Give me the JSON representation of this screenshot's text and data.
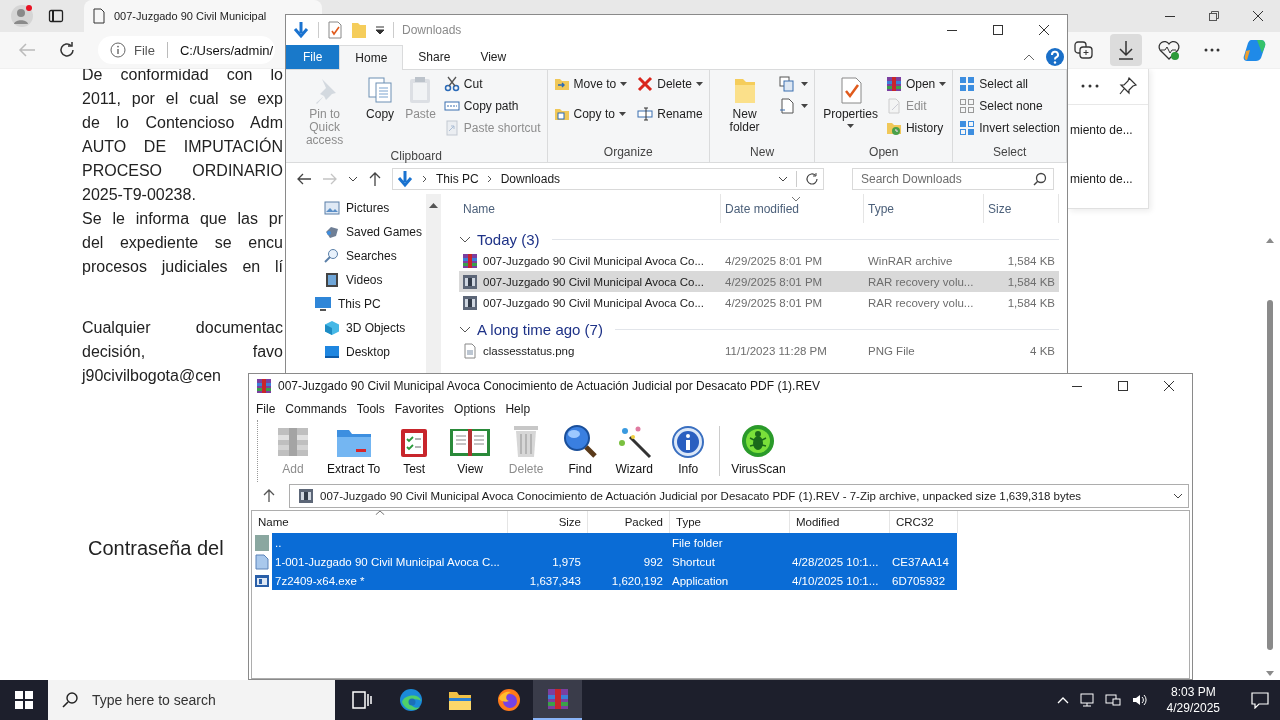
{
  "browser": {
    "tab": {
      "title": "007-Juzgado 90 Civil Municipal"
    },
    "address": {
      "scheme": "File",
      "path": "C:/Users/admin/"
    },
    "document": {
      "paragraphs": [
        {
          "lines": [
            "De conformidad con lo",
            "2011, por el cual se exp",
            "de lo Contencioso Adm",
            "AUTO DE IMPUTACIÓN",
            "PROCESO ORDINARIO",
            "2025-T9-00238.",
            "Se le informa que las pr",
            "del expediente se encu",
            "procesos judiciales en lí"
          ]
        },
        {
          "lines": [
            "Cualquier documentac",
            "decisión, favo",
            "j90civilbogota@cen"
          ]
        }
      ],
      "heading": "Contraseña del"
    },
    "downloads_panel": {
      "items": [
        "miento de...",
        "miento de..."
      ]
    }
  },
  "explorer": {
    "title": "Downloads",
    "tabs": [
      {
        "label": "File",
        "kind": "file",
        "selected": false
      },
      {
        "label": "Home",
        "kind": "tab",
        "selected": true
      },
      {
        "label": "Share",
        "kind": "tab",
        "selected": false
      },
      {
        "label": "View",
        "kind": "tab",
        "selected": false
      }
    ],
    "groups": [
      {
        "label": "Clipboard",
        "items": [
          {
            "kind": "large",
            "label": "Pin to Quick access",
            "disabled": true,
            "dropdown": false
          },
          {
            "kind": "large",
            "label": "Copy",
            "disabled": false,
            "dropdown": false
          },
          {
            "kind": "large",
            "label": "Paste",
            "disabled": true,
            "dropdown": false
          },
          {
            "kind": "small",
            "label": "Cut",
            "disabled": false,
            "dropdown": false
          },
          {
            "kind": "small",
            "label": "Copy path",
            "disabled": false,
            "dropdown": false
          },
          {
            "kind": "small",
            "label": "Paste shortcut",
            "disabled": true,
            "dropdown": false
          }
        ]
      },
      {
        "label": "Organize",
        "items": [
          {
            "kind": "small",
            "label": "Move to",
            "disabled": false,
            "dropdown": true
          },
          {
            "kind": "small",
            "label": "Copy to",
            "disabled": false,
            "dropdown": true
          },
          {
            "kind": "small",
            "label": "Delete",
            "disabled": false,
            "dropdown": true
          },
          {
            "kind": "small",
            "label": "Rename",
            "disabled": false,
            "dropdown": false
          }
        ]
      },
      {
        "label": "New",
        "items": [
          {
            "kind": "large",
            "label": "New folder",
            "disabled": false,
            "dropdown": false
          },
          {
            "kind": "small",
            "disabled": false,
            "dropdown": true
          },
          {
            "kind": "small",
            "disabled": false,
            "dropdown": true
          }
        ]
      },
      {
        "label": "Open",
        "items": [
          {
            "kind": "large",
            "label": "Properties",
            "disabled": false,
            "dropdown": true
          },
          {
            "kind": "small",
            "label": "Open",
            "disabled": false,
            "dropdown": true
          },
          {
            "kind": "small",
            "label": "Edit",
            "disabled": true,
            "dropdown": false
          },
          {
            "kind": "small",
            "label": "History",
            "disabled": false,
            "dropdown": false
          }
        ]
      },
      {
        "label": "Select",
        "items": [
          {
            "kind": "small",
            "label": "Select all",
            "disabled": false,
            "dropdown": false
          },
          {
            "kind": "small",
            "label": "Select none",
            "disabled": false,
            "dropdown": false
          },
          {
            "kind": "small",
            "label": "Invert selection",
            "disabled": false,
            "dropdown": false
          }
        ]
      }
    ],
    "breadcrumb": [
      "This PC",
      "Downloads"
    ],
    "search": {
      "placeholder": "Search Downloads"
    },
    "sidebar": {
      "items": [
        {
          "label": "Pictures"
        },
        {
          "label": "Saved Games"
        },
        {
          "label": "Searches"
        },
        {
          "label": "Videos"
        },
        {
          "label": "This PC",
          "children": [
            {
              "label": "3D Objects"
            },
            {
              "label": "Desktop"
            }
          ]
        }
      ]
    },
    "columns": [
      {
        "label": "Name",
        "sorted": false
      },
      {
        "label": "Date modified",
        "sorted": true
      },
      {
        "label": "Type",
        "sorted": false
      },
      {
        "label": "Size",
        "sorted": false
      }
    ],
    "file_groups": [
      {
        "label": "Today (3)",
        "expanded": true,
        "files": [
          {
            "kind": "archive",
            "name": "007-Juzgado 90 Civil Municipal Avoca Co...",
            "date": "4/29/2025 8:01 PM",
            "type": "WinRAR archive",
            "size": "1,584 KB",
            "selected": false
          },
          {
            "kind": "recovery",
            "name": "007-Juzgado 90 Civil Municipal Avoca Co...",
            "date": "4/29/2025 8:01 PM",
            "type": "RAR recovery volu...",
            "size": "1,584 KB",
            "selected": true
          },
          {
            "kind": "recovery",
            "name": "007-Juzgado 90 Civil Municipal Avoca Co...",
            "date": "4/29/2025 8:01 PM",
            "type": "RAR recovery volu...",
            "size": "1,584 KB",
            "selected": false
          }
        ]
      },
      {
        "label": "A long time ago (7)",
        "expanded": true,
        "files": [
          {
            "kind": "image",
            "name": "classesstatus.png",
            "date": "11/1/2023 11:28 PM",
            "type": "PNG File",
            "size": "4 KB",
            "selected": false
          }
        ]
      }
    ]
  },
  "winrar": {
    "title": "007-Juzgado 90 Civil Municipal Avoca Conocimiento de Actuación Judicial por Desacato PDF (1).REV",
    "menu": [
      "File",
      "Commands",
      "Tools",
      "Favorites",
      "Options",
      "Help"
    ],
    "toolbar": [
      {
        "kind": "add",
        "label": "Add",
        "disabled": true
      },
      {
        "kind": "extract",
        "label": "Extract To",
        "disabled": false
      },
      {
        "kind": "test",
        "label": "Test",
        "disabled": false
      },
      {
        "kind": "view",
        "label": "View",
        "disabled": false
      },
      {
        "kind": "delete",
        "label": "Delete",
        "disabled": true
      },
      {
        "kind": "find",
        "label": "Find",
        "disabled": false
      },
      {
        "kind": "wizard",
        "label": "Wizard",
        "disabled": false
      },
      {
        "kind": "info",
        "label": "Info",
        "disabled": false
      },
      {
        "kind": "scan",
        "label": "VirusScan",
        "disabled": false
      }
    ],
    "path": "007-Juzgado 90 Civil Municipal Avoca Conocimiento de Actuación Judicial por Desacato PDF (1).REV - 7-Zip archive, unpacked size 1,639,318 bytes",
    "columns": [
      {
        "label": "Name",
        "sorted": true
      },
      {
        "label": "Size",
        "sorted": false
      },
      {
        "label": "Packed",
        "sorted": false
      },
      {
        "label": "Type",
        "sorted": false
      },
      {
        "label": "Modified",
        "sorted": false
      },
      {
        "label": "CRC32",
        "sorted": false
      }
    ],
    "files": [
      {
        "kind": "folder",
        "name": "..",
        "type": "File folder",
        "selected": true
      },
      {
        "kind": "shortcut",
        "name": "1-001-Juzgado 90 Civil Municipal Avoca C...",
        "size": "1,975",
        "packed": "992",
        "type": "Shortcut",
        "modified": "4/28/2025 10:1...",
        "crc": "CE37AA14",
        "selected": true
      },
      {
        "kind": "app",
        "name": "7z2409-x64.exe *",
        "size": "1,637,343",
        "packed": "1,620,192",
        "type": "Application",
        "modified": "4/10/2025 10:1...",
        "crc": "6D705932",
        "selected": true
      }
    ]
  },
  "taskbar": {
    "search": {
      "placeholder": "Type here to search"
    },
    "apps": [
      {
        "kind": "task_view",
        "active": false
      },
      {
        "kind": "edge",
        "active": false
      },
      {
        "kind": "explorer",
        "active": false
      },
      {
        "kind": "firefox",
        "active": false
      },
      {
        "kind": "winrar",
        "active": true
      }
    ],
    "clock": {
      "time": "8:03 PM",
      "date": "4/29/2025"
    }
  }
}
